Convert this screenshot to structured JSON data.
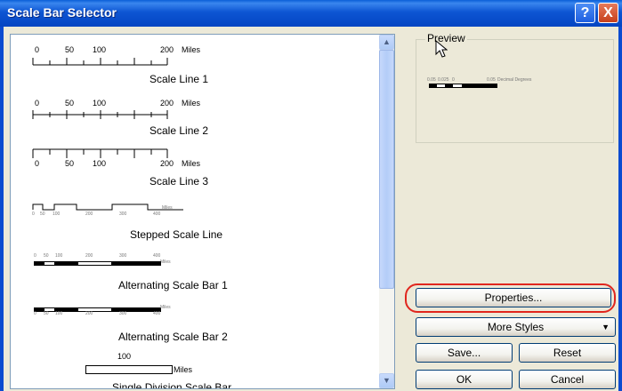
{
  "window": {
    "title": "Scale Bar Selector",
    "help_label": "?",
    "close_label": "X"
  },
  "list": {
    "items": [
      {
        "name": "Scale Line 1",
        "ticks": [
          "0",
          "50",
          "100",
          "200",
          "Miles"
        ]
      },
      {
        "name": "Scale Line 2",
        "ticks": [
          "0",
          "50",
          "100",
          "200",
          "Miles"
        ]
      },
      {
        "name": "Scale Line 3",
        "ticks": [
          "0",
          "50",
          "100",
          "200",
          "Miles"
        ]
      },
      {
        "name": "Stepped Scale Line",
        "ticks": [
          "0",
          "50",
          "100",
          "200",
          "300",
          "400",
          "Miles"
        ]
      },
      {
        "name": "Alternating Scale Bar 1",
        "ticks": [
          "0",
          "50",
          "100",
          "200",
          "300",
          "400",
          "Miles"
        ]
      },
      {
        "name": "Alternating Scale Bar 2",
        "ticks": [
          "0",
          "50",
          "100",
          "200",
          "300",
          "400",
          "Miles"
        ]
      },
      {
        "name": "Single Division Scale Bar",
        "ticks": [
          "100",
          "Miles"
        ]
      }
    ]
  },
  "preview": {
    "label": "Preview",
    "ticks": [
      "0.05",
      "0.025",
      "0",
      "0.05",
      "Decimal Degrees"
    ]
  },
  "buttons": {
    "properties": "Properties...",
    "more_styles": "More Styles",
    "save": "Save...",
    "reset": "Reset",
    "ok": "OK",
    "cancel": "Cancel"
  }
}
